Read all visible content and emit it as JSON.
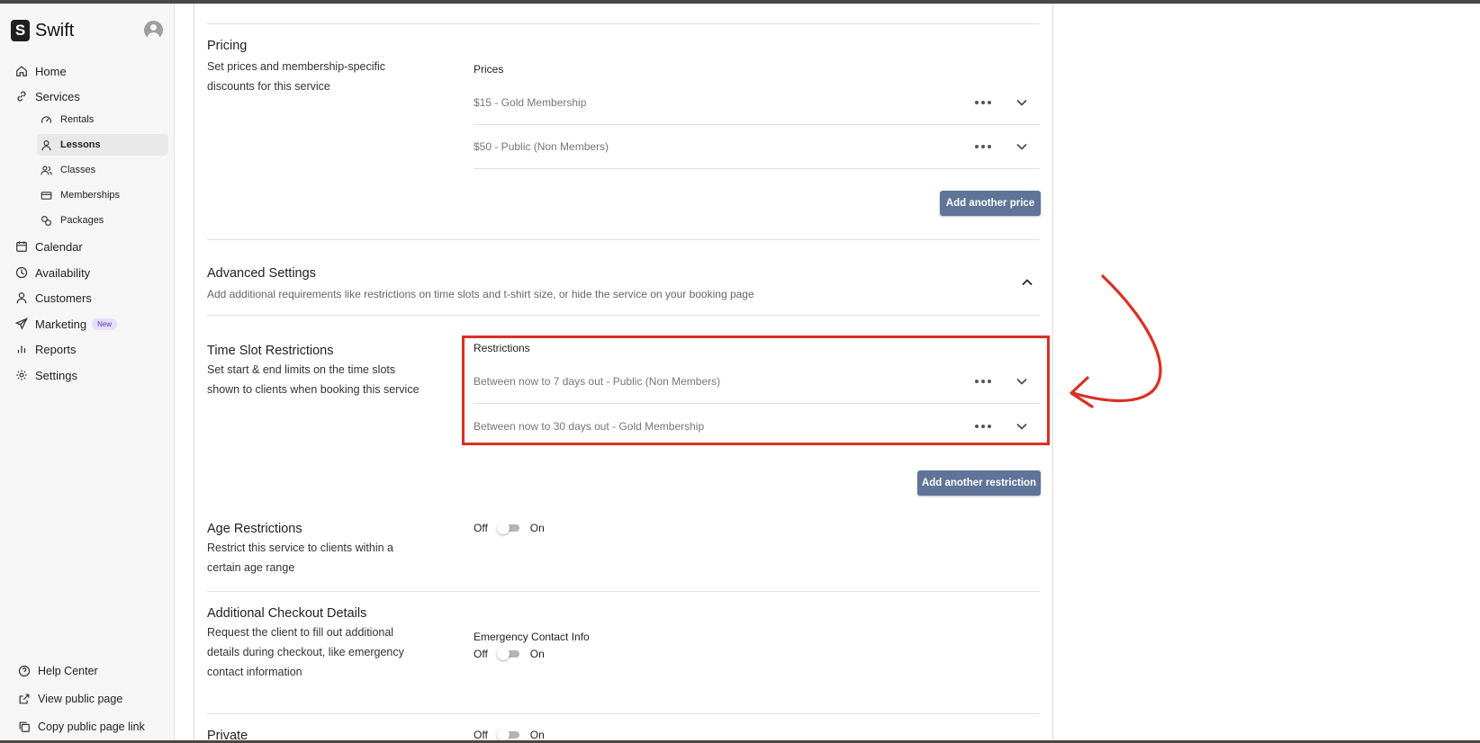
{
  "app": {
    "name": "Swift"
  },
  "sidebar": {
    "nav": [
      {
        "label": "Home",
        "icon": "home-icon"
      },
      {
        "label": "Services",
        "icon": "link-icon"
      }
    ],
    "sub": [
      {
        "label": "Rentals",
        "icon": "gauge-icon"
      },
      {
        "label": "Lessons",
        "icon": "person-icon"
      },
      {
        "label": "Classes",
        "icon": "people-icon"
      },
      {
        "label": "Memberships",
        "icon": "card-icon"
      },
      {
        "label": "Packages",
        "icon": "packages-icon"
      }
    ],
    "nav2": [
      {
        "label": "Calendar",
        "icon": "calendar-icon"
      },
      {
        "label": "Availability",
        "icon": "clock-icon"
      },
      {
        "label": "Customers",
        "icon": "person-icon"
      },
      {
        "label": "Marketing",
        "icon": "send-icon",
        "badge": "New"
      },
      {
        "label": "Reports",
        "icon": "bar-chart-icon"
      },
      {
        "label": "Settings",
        "icon": "gear-icon"
      }
    ],
    "footer": [
      {
        "label": "Help Center",
        "icon": "help-icon"
      },
      {
        "label": "View public page",
        "icon": "external-link-icon"
      },
      {
        "label": "Copy public page link",
        "icon": "copy-icon"
      }
    ]
  },
  "pricing": {
    "title": "Pricing",
    "desc1": "Set prices and membership-specific",
    "desc2": "discounts for this service",
    "prices_label": "Prices",
    "prices": [
      "$15 - Gold Membership",
      "$50 - Public (Non Members)"
    ],
    "add_button": "Add another price"
  },
  "advanced": {
    "title": "Advanced Settings",
    "desc": "Add additional requirements like restrictions on time slots and t-shirt size, or hide the service on your booking page"
  },
  "time_slot": {
    "title": "Time Slot Restrictions",
    "desc1": "Set start & end limits on the time slots",
    "desc2": "shown to clients when booking this service",
    "restrictions_label": "Restrictions",
    "restrictions": [
      "Between now to 7 days out - Public (Non Members)",
      "Between now to 30 days out - Gold Membership"
    ],
    "add_button": "Add another restriction"
  },
  "age": {
    "title": "Age Restrictions",
    "desc1": "Restrict this service to clients within a",
    "desc2": "certain age range",
    "off": "Off",
    "on": "On"
  },
  "checkout": {
    "title": "Additional Checkout Details",
    "desc1": "Request the client to fill out additional",
    "desc2": "details during checkout, like emergency",
    "desc3": "contact information",
    "field_label": "Emergency Contact Info",
    "off": "Off",
    "on": "On"
  },
  "private": {
    "title": "Private",
    "off": "Off",
    "on": "On"
  },
  "colors": {
    "accent_button": "#5f7498",
    "highlight": "#d93025"
  }
}
